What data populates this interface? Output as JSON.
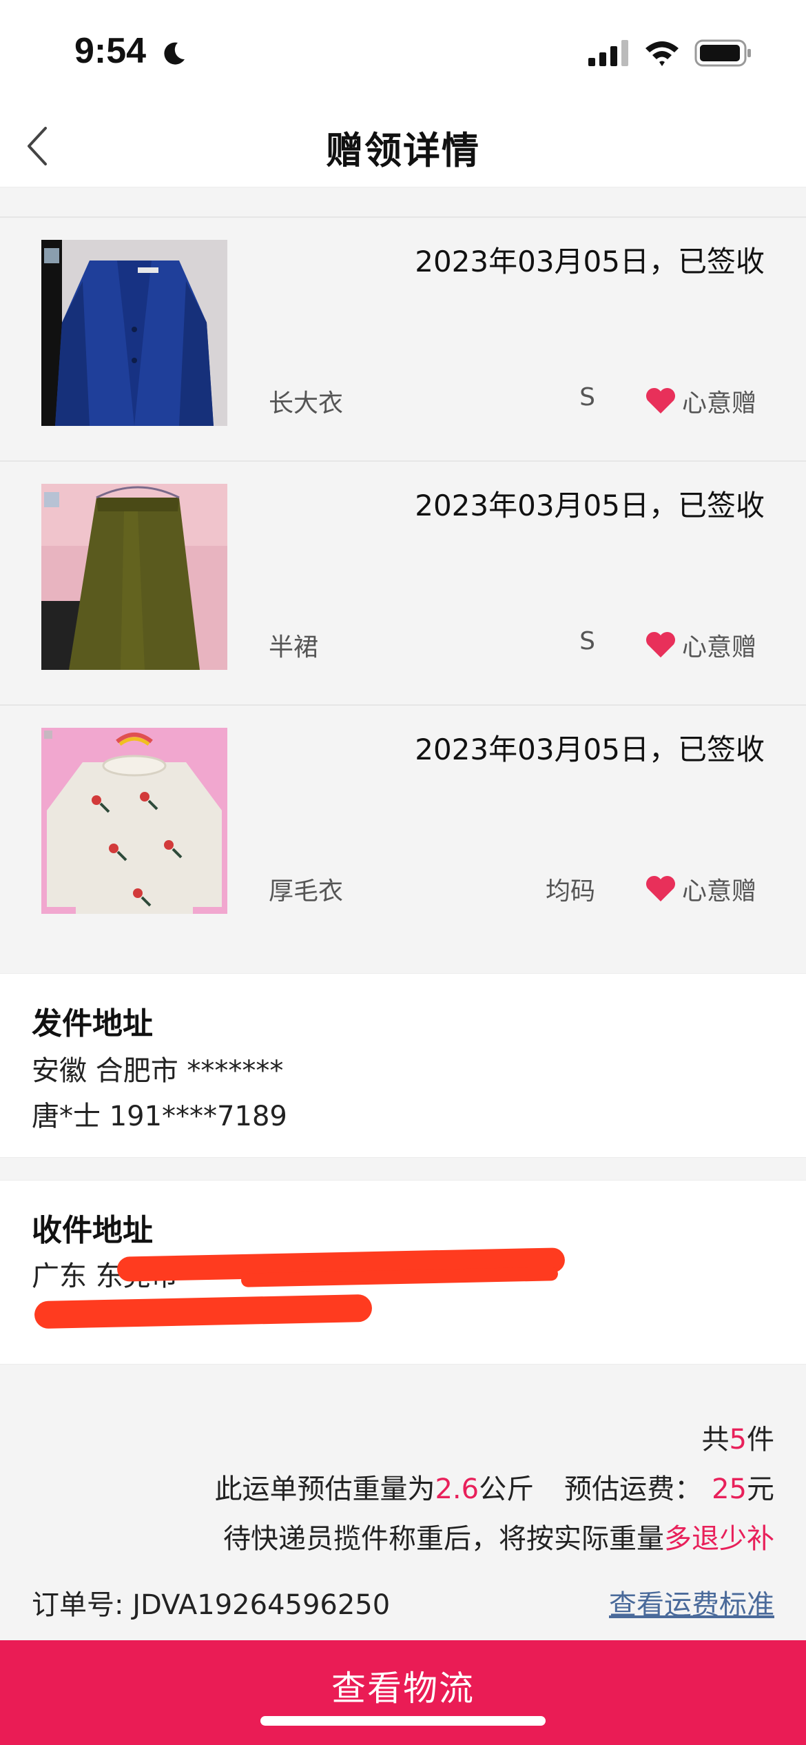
{
  "status_bar": {
    "time": "9:54",
    "icons": [
      "moon-icon",
      "signal-icon",
      "wifi-icon",
      "battery-icon"
    ]
  },
  "nav": {
    "title": "赠领详情",
    "back_icon": "chevron-left-icon"
  },
  "items": [
    {
      "date_status": "2023年03月05日，已签收",
      "name": "长大衣",
      "size": "S",
      "tag": "心意赠",
      "photo": "blue coat"
    },
    {
      "date_status": "2023年03月05日，已签收",
      "name": "半裙",
      "size": "S",
      "tag": "心意赠",
      "photo": "green knit skirt"
    },
    {
      "date_status": "2023年03月05日，已签收",
      "name": "厚毛衣",
      "size": "均码",
      "tag": "心意赠",
      "photo": "white sweater with embroidered flowers"
    }
  ],
  "sender": {
    "title": "发件地址",
    "address": "安徽 合肥市 *******",
    "contact": "唐*士 191****7189"
  },
  "receiver": {
    "title": "收件地址",
    "address": "广东 东莞市",
    "contact": ""
  },
  "summary": {
    "total_prefix": "共",
    "total_count": "5",
    "total_suffix": "件",
    "weight_prefix": "此运单预估重量为",
    "weight_value": "2.6",
    "weight_unit": "公斤",
    "fee_prefix": "预估运费：",
    "fee_value": "25",
    "fee_unit": "元",
    "note_prefix": "待快递员揽件称重后，将按实际重量",
    "note_highlight": "多退少补",
    "order_label": "订单号:",
    "order_number": "JDVA19264596250",
    "freight_link": "查看运费标准"
  },
  "bottom_button": {
    "label": "查看物流"
  },
  "colors": {
    "accent": "#e8205a",
    "button": "#ea1c55",
    "link": "#4a6a9a",
    "heart": "#e8305a",
    "redaction": "#ff3b1f"
  }
}
